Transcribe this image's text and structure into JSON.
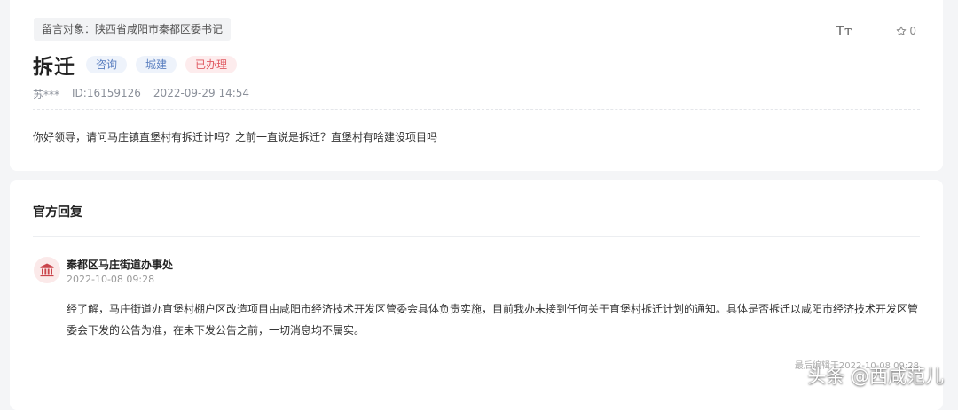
{
  "message": {
    "target": "留言对象：陕西省咸阳市秦都区委书记",
    "title": "拆迁",
    "tags": [
      "咨询",
      "城建",
      "已办理"
    ],
    "author": "苏***",
    "id": "ID:16159126",
    "datetime": "2022-09-29 14:54",
    "content": "你好领导，请问马庄镇直堡村有拆迁计吗？之前一直说是拆迁？直堡村有啥建设项目吗"
  },
  "actions": {
    "font_size_icon": "font-size-icon",
    "font_size_glyph": "Tт",
    "favorite_count": "0"
  },
  "reply": {
    "heading": "官方回复",
    "org_icon": "government-building-icon",
    "org_name": "秦都区马庄街道办事处",
    "org_time": "2022-10-08 09:28",
    "content": "经了解，马庄街道办直堡村棚户区改造项目由咸阳市经济技术开发区管委会具体负责实施，目前我办未接到任何关于直堡村拆迁计划的通知。具体是否拆迁以咸阳市经济技术开发区管委会下发的公告为准，在未下发公告之前，一切消息均不属实。",
    "edited": "最后编辑于2022-10-08 09:28"
  },
  "watermark": "头条 @西咸范儿",
  "colors": {
    "tag_blue_text": "#5a7fc0",
    "tag_red_text": "#e05b63",
    "org_icon": "#c9444b"
  }
}
